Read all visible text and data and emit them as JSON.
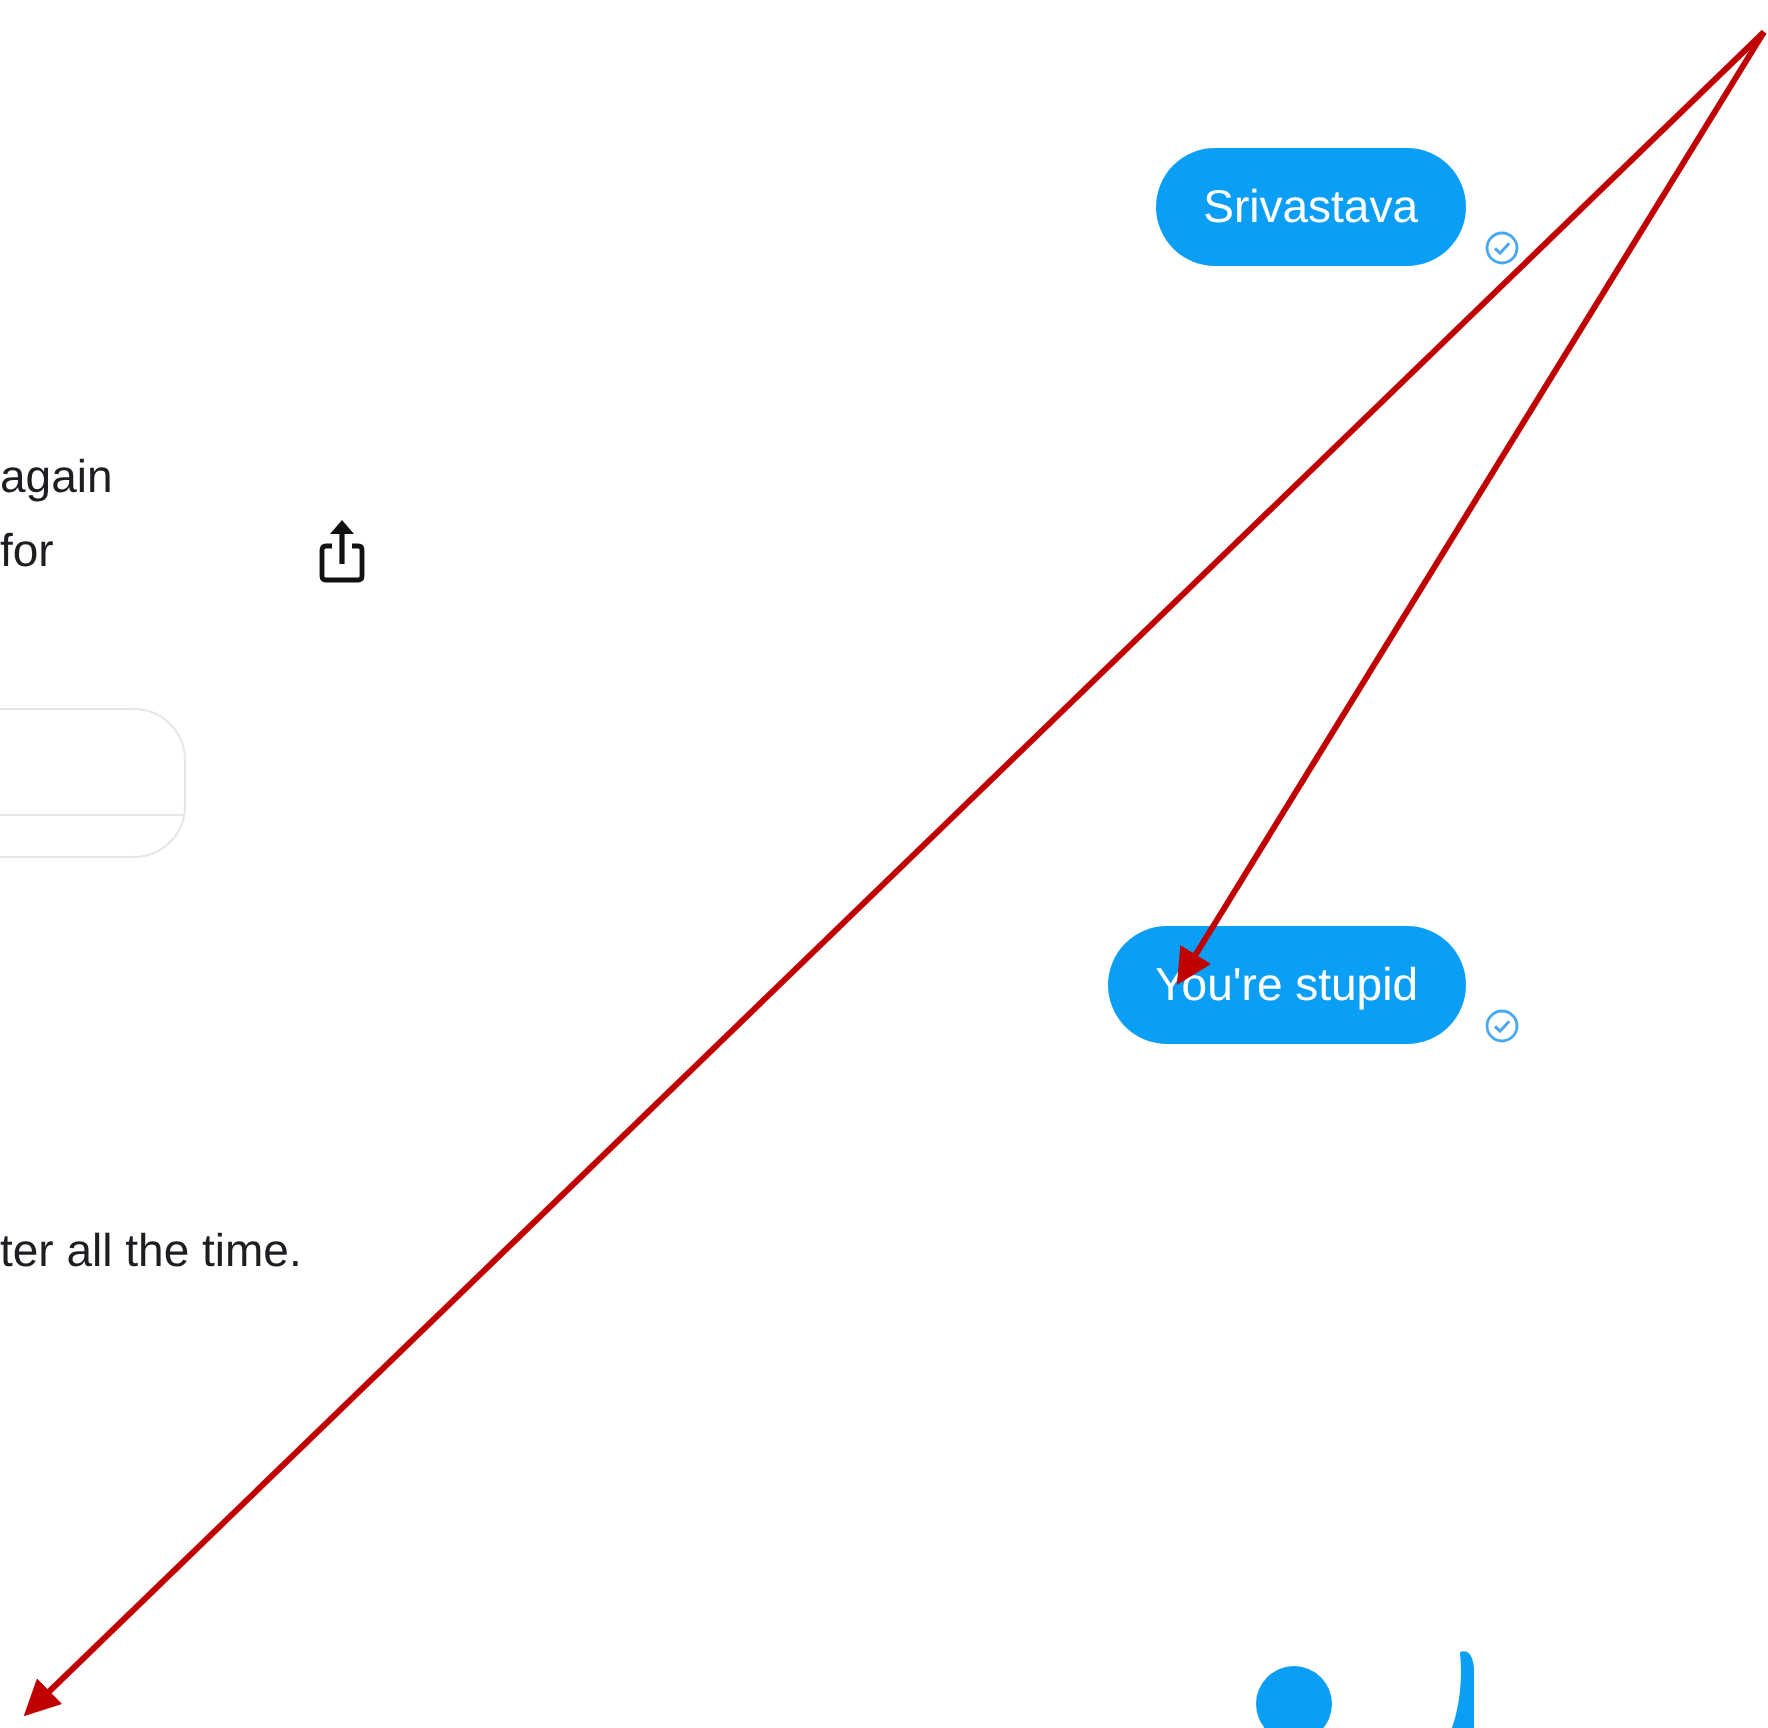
{
  "messages": [
    {
      "kind": "sent",
      "text": "Srivastava",
      "delivered": true
    },
    {
      "kind": "received_text",
      "lines": [
        "again",
        "for"
      ],
      "shareable": true
    },
    {
      "kind": "card"
    },
    {
      "kind": "sent",
      "text": "You're stupid",
      "delivered": true
    },
    {
      "kind": "received_text",
      "lines": [
        "ter all the time."
      ],
      "shareable": false
    },
    {
      "kind": "sticker"
    }
  ]
}
